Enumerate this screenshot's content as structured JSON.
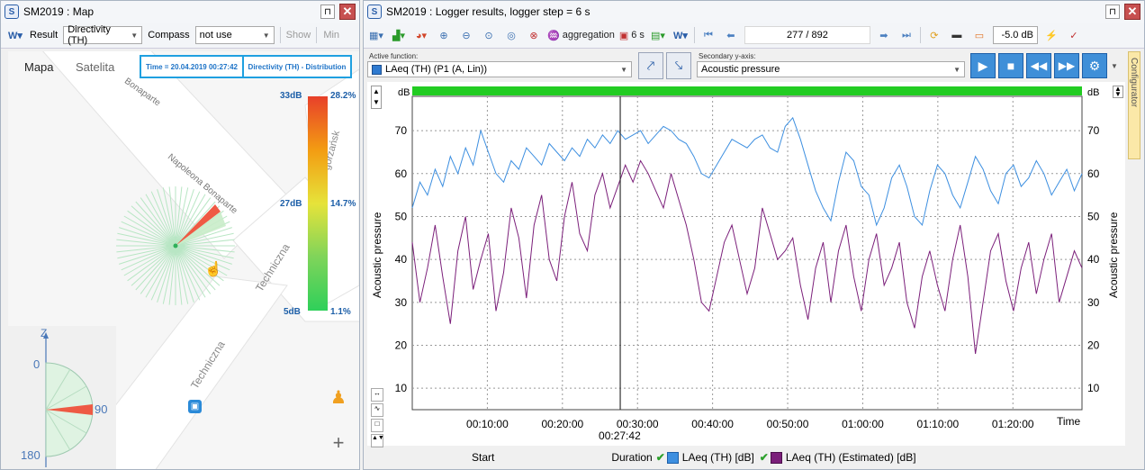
{
  "map_window": {
    "title": "SM2019 : Map",
    "toolbar": {
      "result_label": "Result",
      "result_value": "Directivity (TH)",
      "compass_label": "Compass",
      "compass_value": "not use",
      "show_label": "Show",
      "min_label": "Min"
    },
    "tabs": [
      "Mapa",
      "Satelita"
    ],
    "info_time": "Time = 20.04.2019 00:27:42",
    "info_mode": "Directivity (TH) - Distribution",
    "streets": [
      "Napoleona Bonaparte",
      "Bonaparte",
      "Techniczna",
      "Techniczna",
      "gorzańsk"
    ],
    "scale": {
      "top_db": "33dB",
      "mid_db": "27dB",
      "bot_db": "5dB",
      "top_pct": "28.2%",
      "mid_pct": "14.7%",
      "bot_pct": "1.1%",
      "colors": [
        "#e8402a",
        "#f39c12",
        "#e6e33a",
        "#7fd45a",
        "#2fd05a"
      ]
    },
    "compass": {
      "z_label": "Z",
      "labels": [
        "0",
        "90",
        "180"
      ]
    },
    "zoom_in": "+"
  },
  "logger_window": {
    "title": "SM2019 : Logger results, logger step = 6 s",
    "toolbar": {
      "aggregation_label": "aggregation",
      "step_label": "6 s",
      "position": "277 / 892",
      "db_offset": "-5.0 dB"
    },
    "active_function_label": "Active function:",
    "active_function_value": "LAeq (TH) (P1 (A, Lin))",
    "secondary_axis_label": "Secondary y-axis:",
    "secondary_axis_value": "Acoustic pressure",
    "configurator_label": "Configurator",
    "legend": {
      "start": "Start",
      "duration": "Duration",
      "series1": "LAeq (TH) [dB]",
      "series2": "LAeq (TH) (Estimated) [dB]"
    },
    "cursor_time": "00:27:42"
  },
  "chart_data": {
    "type": "line",
    "ylabel": "Acoustic pressure",
    "y2label": "Acoustic pressure",
    "unit_left": "dB",
    "unit_right": "dB",
    "ylim": [
      5,
      78
    ],
    "y_ticks": [
      10,
      20,
      30,
      40,
      50,
      60,
      70
    ],
    "x_ticks": [
      "00:10:00",
      "00:20:00",
      "00:30:00",
      "00:40:00",
      "00:50:00",
      "01:00:00",
      "01:10:00",
      "01:20:00"
    ],
    "x_tick_minutes": [
      10,
      20,
      30,
      40,
      50,
      60,
      70,
      80
    ],
    "x_axis_end_label": "Time",
    "xlim_minutes": [
      0,
      89.2
    ],
    "cursor_minutes": 27.7,
    "grid": true,
    "colors": {
      "series1": "#3d8fe0",
      "series2": "#7b1f7a",
      "top_bar": "#22cc22"
    },
    "series": [
      {
        "name": "LAeq (TH) [dB]",
        "values": [
          52,
          58,
          55,
          61,
          57,
          64,
          60,
          66,
          62,
          70,
          65,
          60,
          58,
          63,
          61,
          66,
          64,
          62,
          67,
          65,
          63,
          66,
          64,
          68,
          66,
          69,
          67,
          70,
          68,
          69,
          70,
          67,
          69,
          71,
          70,
          68,
          67,
          64,
          60,
          59,
          62,
          65,
          68,
          67,
          66,
          68,
          69,
          66,
          65,
          71,
          73,
          68,
          62,
          56,
          52,
          49,
          58,
          65,
          63,
          57,
          55,
          48,
          52,
          59,
          62,
          57,
          50,
          48,
          56,
          62,
          60,
          55,
          52,
          58,
          64,
          61,
          56,
          53,
          60,
          62,
          57,
          59,
          63,
          60,
          55,
          58,
          61,
          56,
          60
        ]
      },
      {
        "name": "LAeq (TH) (Estimated) [dB]",
        "values": [
          44,
          30,
          38,
          48,
          36,
          25,
          42,
          50,
          33,
          40,
          46,
          28,
          37,
          52,
          45,
          31,
          48,
          55,
          40,
          35,
          50,
          58,
          46,
          42,
          55,
          60,
          52,
          57,
          62,
          58,
          63,
          60,
          56,
          52,
          60,
          54,
          48,
          40,
          30,
          28,
          36,
          44,
          48,
          40,
          32,
          38,
          52,
          46,
          40,
          42,
          45,
          34,
          26,
          38,
          44,
          30,
          42,
          48,
          36,
          28,
          40,
          46,
          34,
          38,
          44,
          30,
          24,
          36,
          42,
          34,
          28,
          40,
          48,
          36,
          18,
          30,
          42,
          46,
          35,
          28,
          38,
          44,
          32,
          40,
          46,
          30,
          36,
          42,
          38
        ]
      }
    ]
  }
}
